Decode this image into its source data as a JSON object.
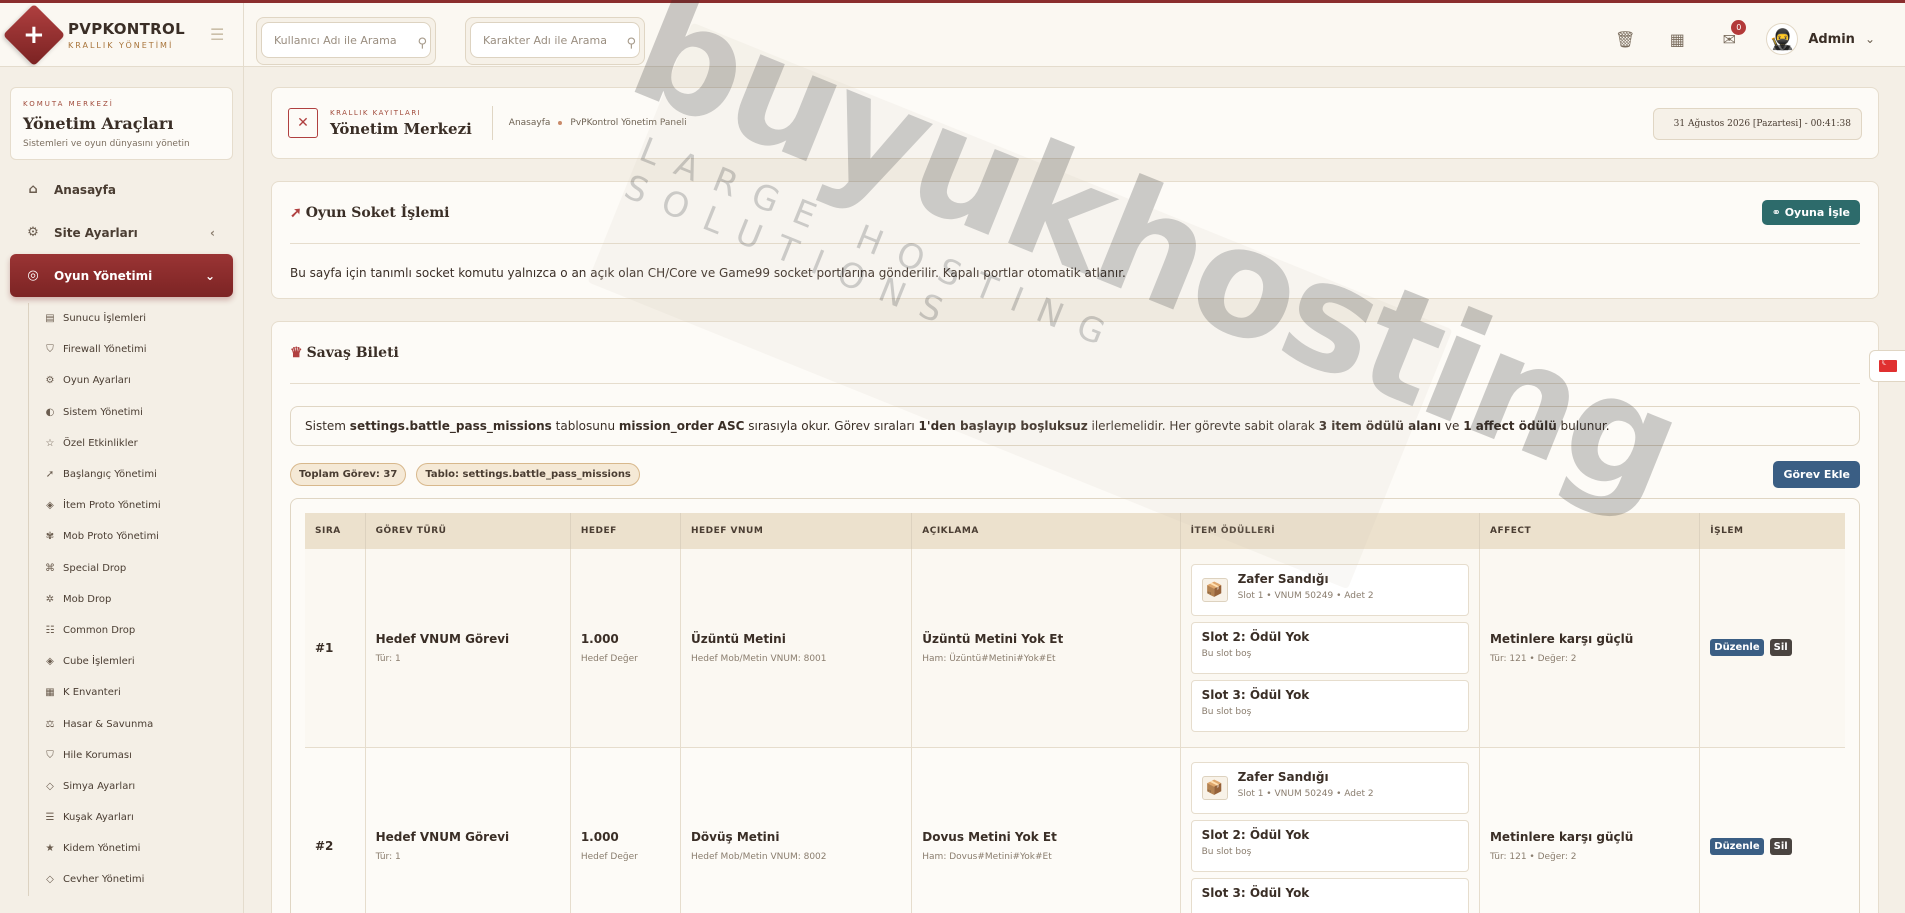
{
  "brand": {
    "name": "PVPKONTROL",
    "subtitle": "KRALLIK YÖNETİMİ"
  },
  "header": {
    "search_user_placeholder": "Kullanıcı Adı ile Arama",
    "search_char_placeholder": "Karakter Adı ile Arama",
    "notification_count": "0",
    "user_name": "Admin"
  },
  "sidebar": {
    "card": {
      "kicker": "KOMUTA MERKEZİ",
      "title": "Yönetim Araçları",
      "desc": "Sistemleri ve oyun dünyasını yönetin"
    },
    "items": [
      {
        "label": "Anasayfa",
        "icon": "home-icon"
      },
      {
        "label": "Site Ayarları",
        "icon": "gear-icon"
      },
      {
        "label": "Oyun Yönetimi",
        "icon": "gamepad-icon"
      }
    ],
    "subitems": [
      "Sunucu İşlemleri",
      "Firewall Yönetimi",
      "Oyun Ayarları",
      "Sistem Yönetimi",
      "Özel Etkinlikler",
      "Başlangıç Yönetimi",
      "İtem Proto Yönetimi",
      "Mob Proto Yönetimi",
      "Special Drop",
      "Mob Drop",
      "Common Drop",
      "Cube İşlemleri",
      "K Envanteri",
      "Hasar & Savunma",
      "Hile Koruması",
      "Simya Ayarları",
      "Kuşak Ayarları",
      "Kidem Yönetimi",
      "Cevher Yönetimi"
    ]
  },
  "crumb": {
    "kicker": "KRALLIK KAYITLARI",
    "title": "Yönetim Merkezi",
    "bc1": "Anasayfa",
    "bc2": "PvPKontrol Yönetim Paneli",
    "datetime": "31 Ağustos 2026 [Pazartesi] - 00:41:38"
  },
  "socket_panel": {
    "title": "Oyun Soket İşlemi",
    "button": "Oyuna İşle",
    "body": "Bu sayfa için tanımlı socket komutu yalnızca o an açık olan CH/Core ve Game99 socket portlarına gönderilir. Kapalı portlar otomatik atlanır."
  },
  "battle_panel": {
    "title": "Savaş Bileti",
    "info": {
      "p1": "Sistem ",
      "b1": "settings.battle_pass_missions",
      "p2": " tablosunu ",
      "b2": "mission_order ASC",
      "p3": " sırasıyla okur. Görev sıraları ",
      "b3": "1'den başlayıp boşluksuz",
      "p4": " ilerlemelidir. Her görevte sabit olarak ",
      "b4": "3 item ödülü alanı",
      "p5": " ve ",
      "b5": "1 affect ödülü",
      "p6": " bulunur."
    },
    "pill_total": "Toplam Görev: 37",
    "pill_table": "Tablo: settings.battle_pass_missions",
    "add_button": "Görev Ekle",
    "columns": [
      "SIRA",
      "GÖREV TÜRÜ",
      "HEDEF",
      "HEDEF VNUM",
      "AÇIKLAMA",
      "İTEM ÖDÜLLERİ",
      "AFFECT",
      "İŞLEM"
    ],
    "rows": [
      {
        "rank": "#1",
        "type": "Hedef VNUM Görevi",
        "type_sub": "Tür: 1",
        "target": "1.000",
        "target_sub": "Hedef Değer",
        "vnum": "Üzüntü Metini",
        "vnum_sub": "Hedef Mob/Metin VNUM: 8001",
        "desc": "Üzüntü Metini Yok Et",
        "desc_sub": "Ham: Üzüntü#Metini#Yok#Et",
        "r1_title": "Zafer Sandığı",
        "r1_sub": "Slot 1 • VNUM 50249 • Adet 2",
        "r2_title": "Slot 2: Ödül Yok",
        "r2_sub": "Bu slot boş",
        "r3_title": "Slot 3: Ödül Yok",
        "r3_sub": "Bu slot boş",
        "affect": "Metinlere karşı güçlü",
        "affect_sub": "Tür: 121 • Değer: 2",
        "edit": "Düzenle",
        "del": "Sil"
      },
      {
        "rank": "#2",
        "type": "Hedef VNUM Görevi",
        "type_sub": "Tür: 1",
        "target": "1.000",
        "target_sub": "Hedef Değer",
        "vnum": "Dövüş Metini",
        "vnum_sub": "Hedef Mob/Metin VNUM: 8002",
        "desc": "Dovus Metini Yok Et",
        "desc_sub": "Ham: Dovus#Metini#Yok#Et",
        "r1_title": "Zafer Sandığı",
        "r1_sub": "Slot 1 • VNUM 50249 • Adet 2",
        "r2_title": "Slot 2: Ödül Yok",
        "r2_sub": "Bu slot boş",
        "r3_title": "Slot 3: Ödül Yok",
        "r3_sub": "",
        "affect": "Metinlere karşı güçlü",
        "affect_sub": "Tür: 121 • Değer: 2",
        "edit": "Düzenle",
        "del": "Sil"
      }
    ]
  },
  "watermark": {
    "line1": "buyukhosting",
    "line2": "LARGE HOSTING SOLUTIONS"
  },
  "colors": {
    "accent": "#8b2e2e",
    "teal": "#2d6b6b",
    "blue": "#3a5e84",
    "bg": "#f4efe6"
  }
}
